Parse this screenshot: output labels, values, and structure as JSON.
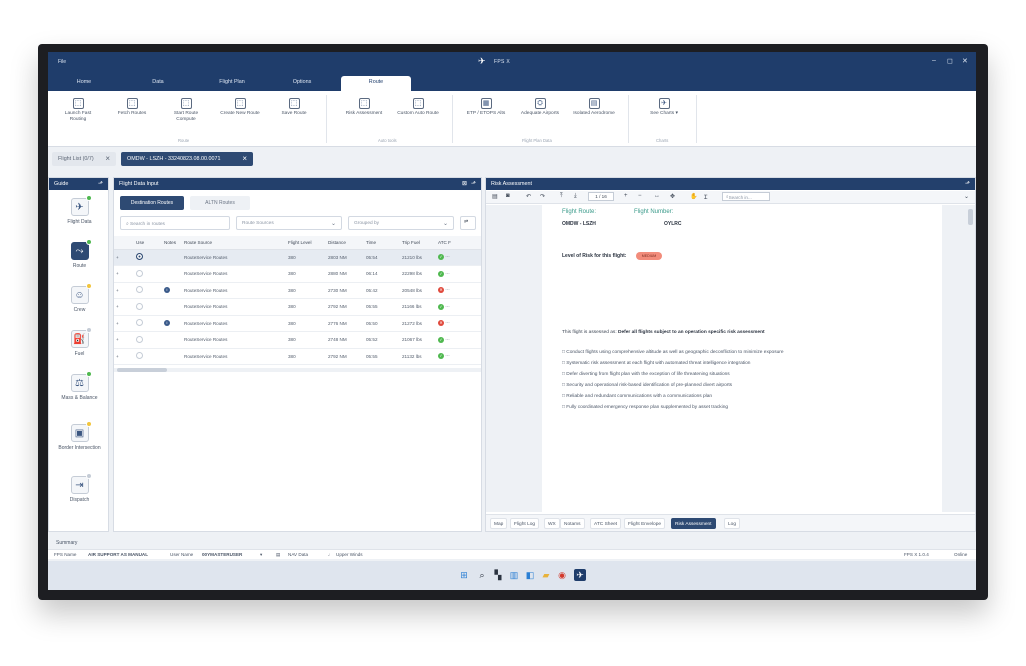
{
  "window": {
    "file_menu": "File",
    "app_title": "FPS X",
    "min": "–",
    "max": "◻",
    "close": "✕"
  },
  "tabs": [
    "Home",
    "Data",
    "Flight Plan",
    "Options",
    "Route"
  ],
  "ribbon": {
    "buttons": [
      {
        "label": "Launch Fast Routing",
        "icon": "⬚"
      },
      {
        "label": "Fetch Routes",
        "icon": "⬚"
      },
      {
        "label": "Start Route Compute",
        "icon": "⬚"
      },
      {
        "label": "Create New Route",
        "icon": "⬚"
      },
      {
        "label": "Save Route",
        "icon": "⬚"
      },
      {
        "label": "Risk Assessment",
        "icon": "⬚"
      },
      {
        "label": "Custom Auto Route",
        "icon": "⬚"
      },
      {
        "label": "ETP / ETOPS Alts",
        "icon": "▦"
      },
      {
        "label": "Adequate Airports",
        "icon": "⛭"
      },
      {
        "label": "Isolated Aerodrome",
        "icon": "▤"
      },
      {
        "label": "See Charts ▾",
        "icon": "✈"
      }
    ],
    "groups": [
      "Route",
      "Auto tools",
      "Flight Plan Data",
      "Charts"
    ]
  },
  "doc_tabs": {
    "inactive": "Flight List (0/7)",
    "active": "OMDW - LSZH - 33240823.08.00.0071"
  },
  "guide": {
    "title": "Guide",
    "items": [
      {
        "label": "Flight Data",
        "icon": "✈",
        "badge": "#4fb84f"
      },
      {
        "label": "Route",
        "icon": "⤳",
        "badge": "#4fb84f"
      },
      {
        "label": "Crew",
        "icon": "☺",
        "badge": "#f2c53d"
      },
      {
        "label": "Fuel",
        "icon": "⛽",
        "badge": "#c5ccd6"
      },
      {
        "label": "Mass & Balance",
        "icon": "⚖",
        "badge": "#4fb84f"
      },
      {
        "label": "Border Intersection",
        "icon": "▣",
        "badge": "#f2c53d"
      },
      {
        "label": "Dispatch",
        "icon": "⇥",
        "badge": "#c5ccd6"
      }
    ]
  },
  "fdi": {
    "title": "Flight Data Input",
    "subtabs": [
      "Destination Routes",
      "ALTN Routes"
    ],
    "search_placeholder": "Search in routes",
    "route_source": "Route Sources",
    "grouped_by": "Grouped by",
    "columns": [
      "",
      "Use",
      "Notes",
      "Route Source",
      "Flight Level",
      "Distance",
      "Time",
      "Trip Fuel",
      "ATC F"
    ],
    "rows": [
      {
        "source": "RouteService Routes",
        "fl": "380",
        "dist": "2803 NM",
        "time": "05:54",
        "fuel": "21210 lbs",
        "atc": "#4fb84f",
        "use": true,
        "note": false
      },
      {
        "source": "RouteService Routes",
        "fl": "380",
        "dist": "2880 NM",
        "time": "06:14",
        "fuel": "22298 lbs",
        "atc": "#4fb84f",
        "use": false,
        "note": false
      },
      {
        "source": "RouteService Routes",
        "fl": "380",
        "dist": "2730 NM",
        "time": "05:42",
        "fuel": "20548 lbs",
        "atc": "#e0483b",
        "use": false,
        "note": true
      },
      {
        "source": "RouteService Routes",
        "fl": "380",
        "dist": "2792 NM",
        "time": "05:55",
        "fuel": "21166 lbs",
        "atc": "#4fb84f",
        "use": false,
        "note": false
      },
      {
        "source": "RouteService Routes",
        "fl": "380",
        "dist": "2776 NM",
        "time": "05:50",
        "fuel": "21272 lbs",
        "atc": "#e0483b",
        "use": false,
        "note": true
      },
      {
        "source": "RouteService Routes",
        "fl": "380",
        "dist": "2748 NM",
        "time": "05:52",
        "fuel": "21067 lbs",
        "atc": "#4fb84f",
        "use": false,
        "note": false
      },
      {
        "source": "RouteService Routes",
        "fl": "380",
        "dist": "2792 NM",
        "time": "05:55",
        "fuel": "21132 lbs",
        "atc": "#4fb84f",
        "use": false,
        "note": false
      }
    ]
  },
  "risk": {
    "title": "Risk Assessment",
    "page": "1 / 16",
    "search_placeholder": "Search in...",
    "flight_route_label": "Flight Route:",
    "flight_number_label": "Flight Number:",
    "route_value": "OMDW - LSZH",
    "flight_number_value": "OYLRC",
    "level_label": "Level of Risk for this flight:",
    "level_value": "MEDIUM",
    "assessed_prefix": "This flight is assessed as:",
    "assessed_value": "Defer all flights subject to an operation specific risk assessment",
    "bullets": [
      "□ Conduct flights using comprehensive altitude as well as geographic deconfliction to minimize exposure",
      "□ Systematic risk assessment at each flight with automated threat intelligence integration",
      "□ Defer diverting from flight plan with the exception of life threatening situations",
      "□ Security and operational risk-based identification of pre-planned divert airports",
      "□ Reliable and redundant communications with a communications plan",
      "□ Fully coordinated emergency response plan supplemented by asset tracking"
    ],
    "bottom_tabs": [
      "Map",
      "Flight Log",
      "WX",
      "Notams",
      "ATC Sheet",
      "Flight Envelope",
      "Risk Assessment",
      "Log"
    ]
  },
  "summary": "Summary",
  "status": {
    "fps_name_label": "FPS Name",
    "fps_name_value": "AIR SUPPORT AS MANUAL",
    "user_label": "User Name",
    "user_value": "00YMASTERUSER",
    "nav": "NAV Data",
    "winds": "Upper Winds",
    "version": "FPS X 1.0.4",
    "online": "Online"
  }
}
